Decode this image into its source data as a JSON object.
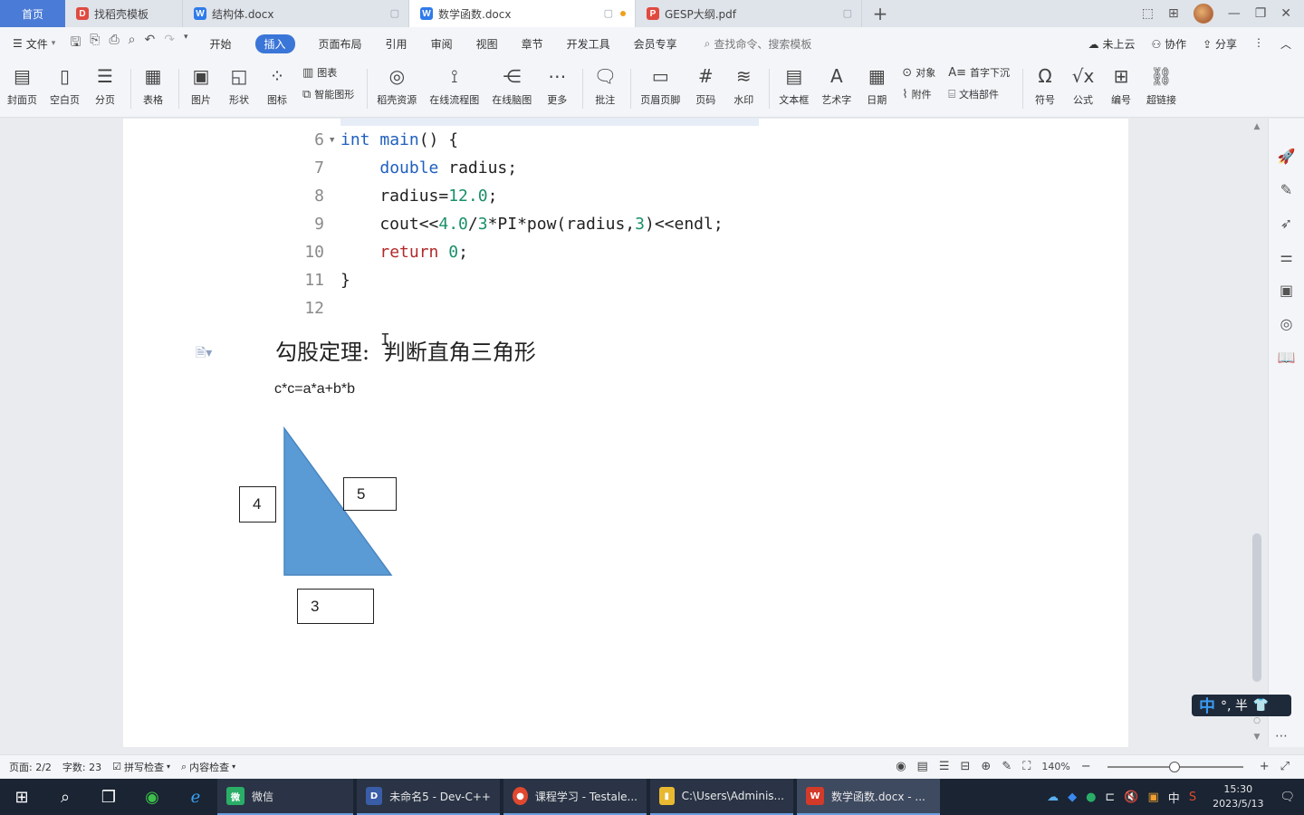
{
  "tabs": {
    "home": "首页",
    "items": [
      {
        "label": "找稻壳模板",
        "icon": "red"
      },
      {
        "label": "结构体.docx",
        "icon": "blue"
      },
      {
        "label": "数学函数.docx",
        "icon": "blue"
      },
      {
        "label": "GESP大纲.pdf",
        "icon": "red"
      }
    ],
    "add": "+"
  },
  "menu": {
    "file": "文件",
    "items": [
      "开始",
      "插入",
      "页面布局",
      "引用",
      "审阅",
      "视图",
      "章节",
      "开发工具",
      "会员专享"
    ],
    "active": "插入",
    "search": "查找命令、搜索模板",
    "right": [
      "未上云",
      "协作",
      "分享"
    ]
  },
  "ribbon": {
    "cover": "封面页",
    "blank": "空白页",
    "pagebreak": "分页",
    "table": "表格",
    "picture": "图片",
    "shape": "形状",
    "iconlib": "图标",
    "chart": "图表",
    "smartart": "智能图形",
    "resources": "稻壳资源",
    "flowchart": "在线流程图",
    "mindmap": "在线脑图",
    "more": "更多",
    "comment": "批注",
    "headerfooter": "页眉页脚",
    "pagenum": "页码",
    "watermark": "水印",
    "textbox": "文本框",
    "wordart": "艺术字",
    "date": "日期",
    "object": "对象",
    "attachment": "附件",
    "dropcap": "首字下沉",
    "docpart": "文档部件",
    "symbol": "符号",
    "formula": "公式",
    "numbering": "编号",
    "hyperlink": "超链接"
  },
  "code": [
    {
      "ln": "6",
      "fold": true,
      "html": "<span class=\"kw-blue\">int</span> <span class=\"kw-blue\">main</span>() {"
    },
    {
      "ln": "7",
      "fold": false,
      "html": "    <span class=\"kw-blue\">double</span> radius;"
    },
    {
      "ln": "8",
      "fold": false,
      "html": "    radius=<span class=\"num\">12.0</span>;"
    },
    {
      "ln": "9",
      "fold": false,
      "html": "    cout&lt;&lt;<span class=\"num\">4.0</span>/<span class=\"num\">3</span>*PI*pow(radius,<span class=\"num\">3</span>)&lt;&lt;endl;"
    },
    {
      "ln": "10",
      "fold": false,
      "html": "    <span class=\"kw-red\">return</span> <span class=\"num\">0</span>;"
    },
    {
      "ln": "11",
      "fold": false,
      "html": "}"
    },
    {
      "ln": "12",
      "fold": false,
      "html": ""
    }
  ],
  "doc": {
    "heading_a": "勾股定理:",
    "heading_b": "判断直角三角形",
    "formula": "c*c=a*a+b*b",
    "triangle_color": "#5b9bd5",
    "labels": {
      "left": "4",
      "hyp": "5",
      "bottom": "3"
    }
  },
  "ime": {
    "mode": "中",
    "rest": "°, 半"
  },
  "status": {
    "page": "页面: 2/2",
    "words": "字数: 23",
    "spell": "拼写检查",
    "content": "内容检查",
    "zoom": "140%"
  },
  "taskbar": {
    "apps": [
      {
        "label": "微信",
        "color": "#2aae67",
        "glyph": "微"
      },
      {
        "label": "未命名5 - Dev-C++",
        "color": "#3a5da8",
        "glyph": "DEV"
      },
      {
        "label": "课程学习 - Testale...",
        "color": "#e0482f",
        "glyph": "●"
      },
      {
        "label": "C:\\Users\\Adminis...",
        "color": "#e8b830",
        "glyph": "▮"
      },
      {
        "label": "数学函数.docx - ...",
        "color": "#d33a2a",
        "glyph": "W"
      }
    ],
    "tray_lang": "中",
    "time": "15:30",
    "date": "2023/5/13"
  }
}
